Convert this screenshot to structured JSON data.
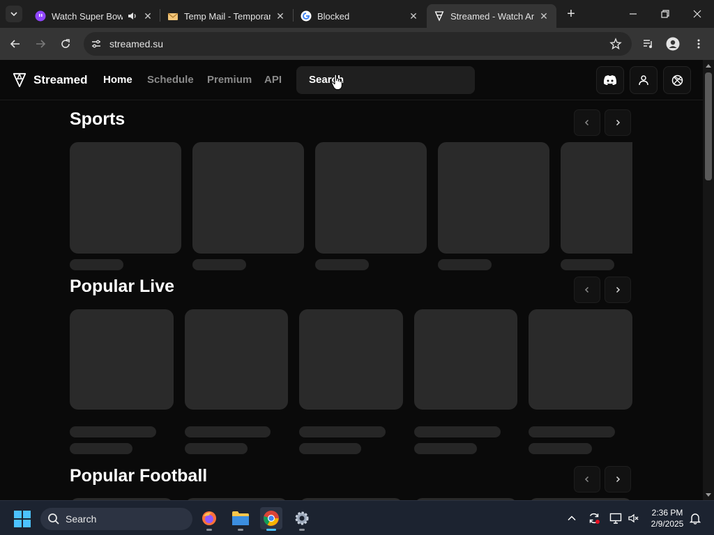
{
  "browser": {
    "tabs": [
      {
        "title": "Watch Super Bowl",
        "icon": "twitch-favicon-icon",
        "active": false
      },
      {
        "title": "Temp Mail - Temporary",
        "icon": "tempmail-favicon-icon",
        "active": false
      },
      {
        "title": "Blocked",
        "icon": "google-favicon-icon",
        "active": false
      },
      {
        "title": "Streamed - Watch Any",
        "icon": "streamed-favicon-icon",
        "active": true
      }
    ],
    "url": "streamed.su"
  },
  "site": {
    "brand": "Streamed",
    "nav": [
      {
        "label": "Home",
        "active": true
      },
      {
        "label": "Schedule",
        "active": false
      },
      {
        "label": "Premium",
        "active": false
      },
      {
        "label": "API",
        "active": false
      }
    ],
    "search_label": "Search",
    "sections": [
      {
        "title": "Sports",
        "cards": 5
      },
      {
        "title": "Popular Live",
        "cards": 5
      },
      {
        "title": "Popular Football",
        "cards": 5
      }
    ]
  },
  "taskbar": {
    "search_label": "Search",
    "time": "2:36 PM",
    "date": "2/9/2025"
  },
  "colors": {
    "background": "#0a0a0a",
    "card": "#2a2a2a",
    "accent": "#4cc2ff"
  }
}
